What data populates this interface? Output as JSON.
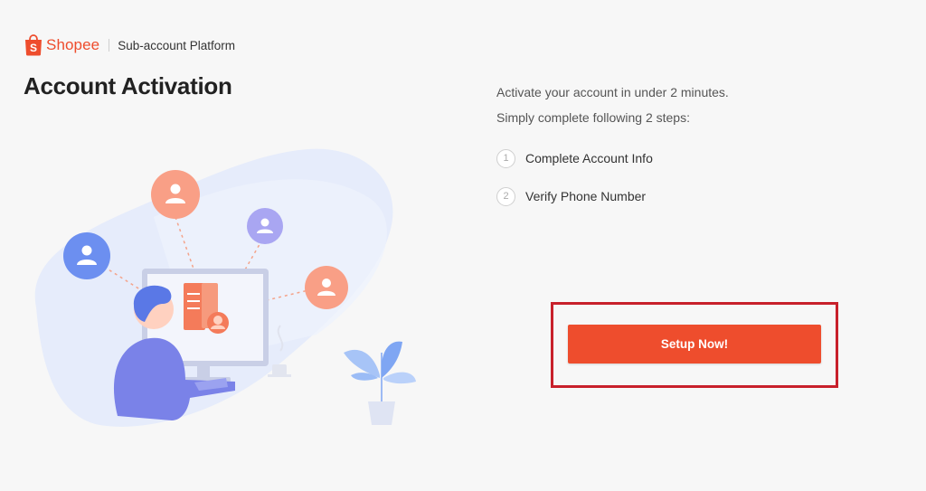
{
  "header": {
    "logo_text": "Shopee",
    "platform_name": "Sub-account Platform"
  },
  "page_title": "Account Activation",
  "intro": {
    "line1": "Activate your account in under 2 minutes.",
    "line2": "Simply complete following 2 steps:"
  },
  "steps": [
    {
      "number": "1",
      "label": "Complete Account Info"
    },
    {
      "number": "2",
      "label": "Verify Phone Number"
    }
  ],
  "setup_button_label": "Setup Now!",
  "colors": {
    "brand": "#ee4d2d",
    "highlight_border": "#c8202b"
  },
  "icons": [
    "shopee-bag-icon",
    "user-icon",
    "computer-illustration",
    "plant-illustration"
  ]
}
